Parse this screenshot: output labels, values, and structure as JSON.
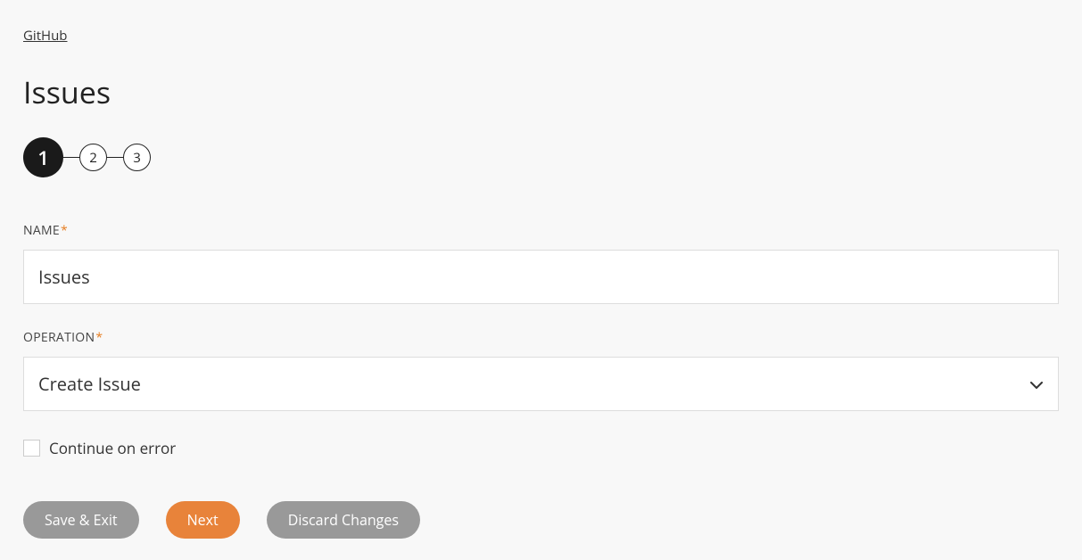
{
  "breadcrumb": {
    "label": "GitHub"
  },
  "page_title": "Issues",
  "stepper": {
    "steps": [
      "1",
      "2",
      "3"
    ],
    "active_index": 0
  },
  "fields": {
    "name": {
      "label": "NAME",
      "required_marker": "*",
      "value": "Issues"
    },
    "operation": {
      "label": "OPERATION",
      "required_marker": "*",
      "value": "Create Issue"
    },
    "continue_on_error": {
      "label": "Continue on error",
      "checked": false
    }
  },
  "buttons": {
    "save_exit": "Save & Exit",
    "next": "Next",
    "discard": "Discard Changes"
  }
}
